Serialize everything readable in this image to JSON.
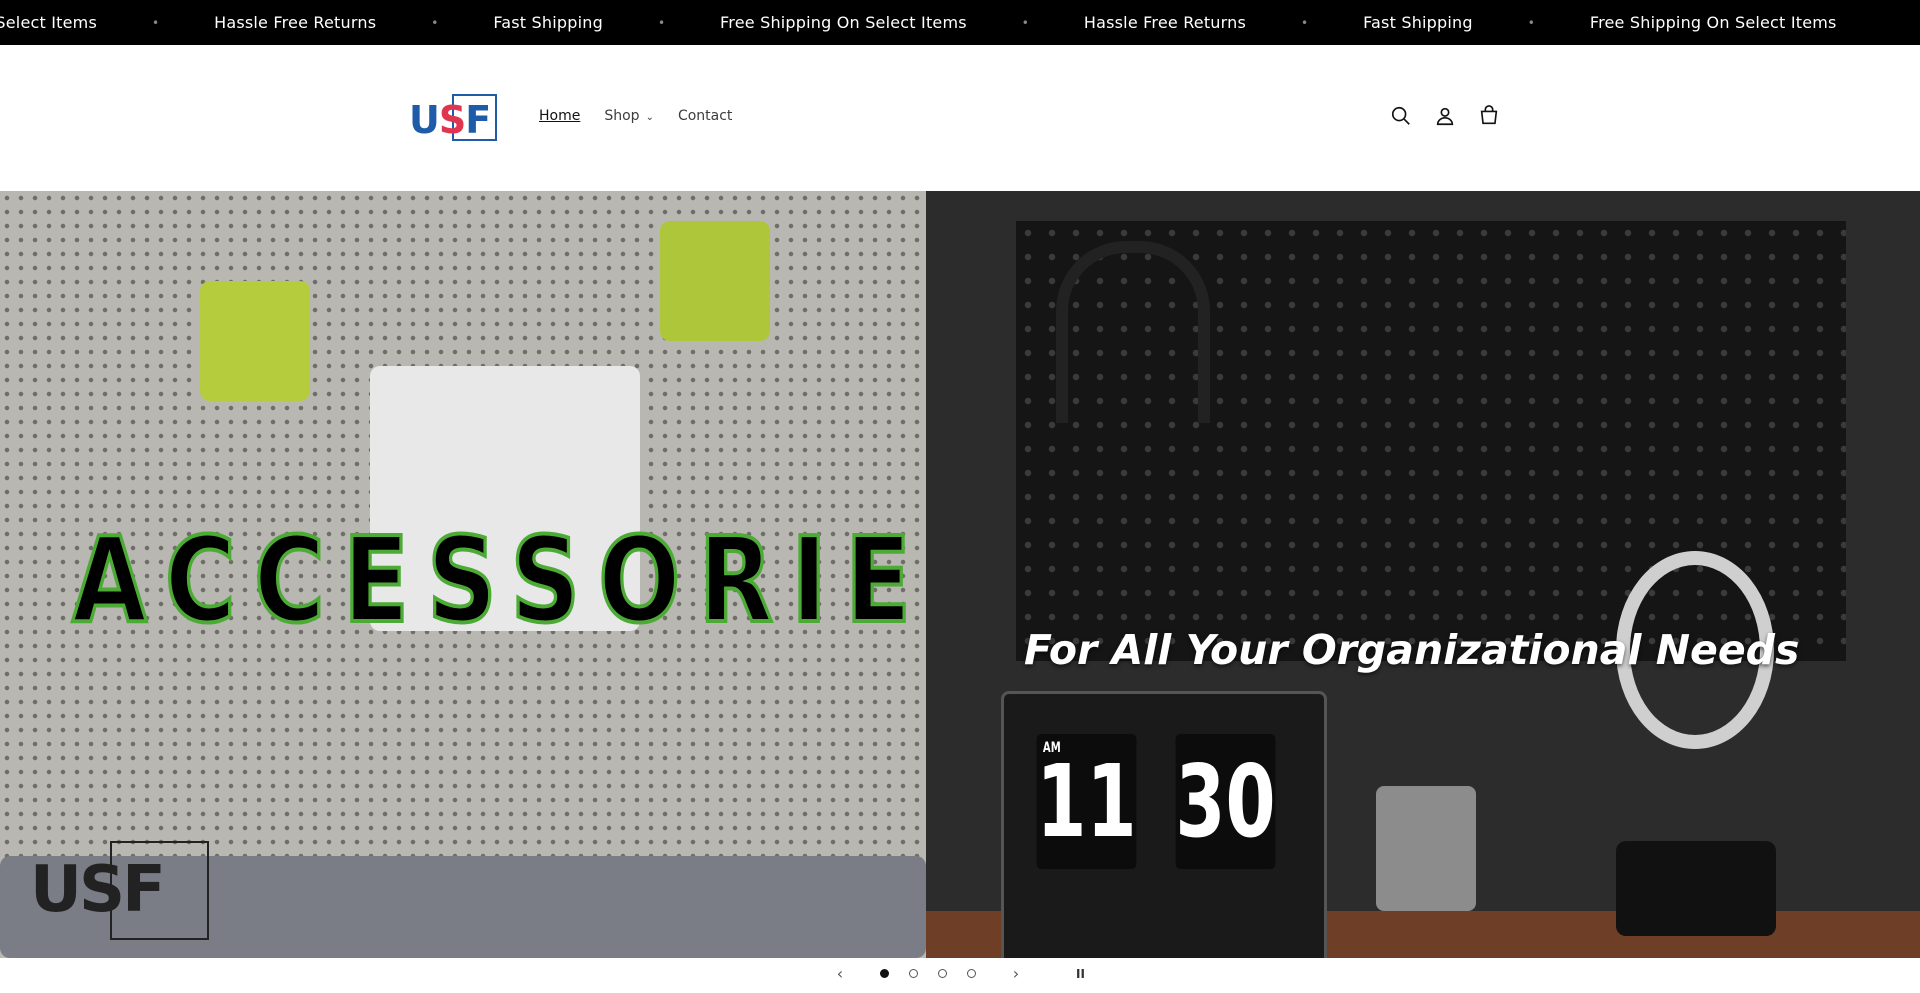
{
  "announcement": {
    "items": [
      "ng On Select Items",
      "Hassle Free Returns",
      "Fast Shipping",
      "Free Shipping On Select Items",
      "Hassle Free Returns",
      "Fast Shipping",
      "Free Shipping On Select Items"
    ]
  },
  "header": {
    "logo": "USF",
    "nav": [
      {
        "label": "Home"
      },
      {
        "label": "Shop"
      },
      {
        "label": "Contact"
      }
    ]
  },
  "hero": {
    "slide_left_heading": "ACCESSORIES",
    "slide_left_watermark": "USF",
    "slide_right_heading": "For All Your Organizational Needs",
    "clock_hour": "11",
    "clock_minute": "30",
    "clock_ampm": "AM"
  },
  "slideshow": {
    "slide_count": 4,
    "active_index": 0
  },
  "colors": {
    "accent_blue": "#1e5ba8",
    "accent_red": "#e0344f",
    "accessories_outline": "#4cab35"
  }
}
